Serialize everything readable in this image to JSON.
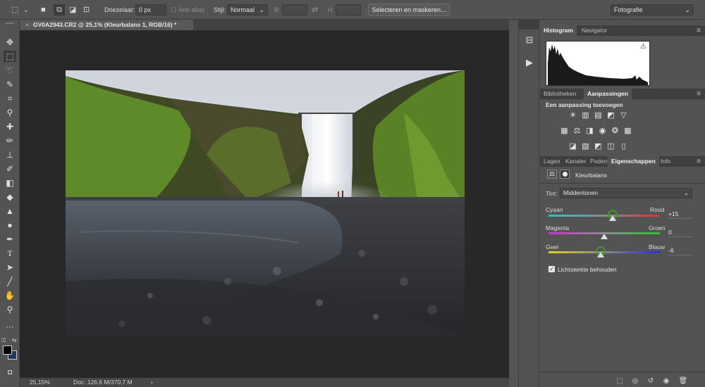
{
  "options_bar": {
    "feather_label": "Doezelaar:",
    "feather_value": "0 px",
    "antialias_label": "Anti-alias",
    "style_label": "Stijl:",
    "style_value": "Normaal",
    "width_label": "B:",
    "height_label": "H:",
    "select_mask_button": "Selecteren en maskeren...",
    "workspace_value": "Fotografie"
  },
  "document_tab": {
    "close_glyph": "×",
    "title": "GV0A2943.CR2 @ 25,1% (Kleurbalans 1, RGB/16) *"
  },
  "status_bar": {
    "zoom": "25,15%",
    "doc_info": "Doc: 126,6 M/370,7 M",
    "arrow": "›"
  },
  "panels": {
    "histogram_tabs": [
      "Histogram",
      "Navigator"
    ],
    "histogram_warning": "⚠",
    "library_tabs": [
      "Bibliotheken",
      "Aanpassingen"
    ],
    "adjustments_heading": "Een aanpassing toevoegen",
    "properties_tabs": [
      "Lagen",
      "Kanaler",
      "Paden",
      "Eigenschappen",
      "Info"
    ],
    "properties_title": "Kleurbalans",
    "tone_label": "Tint:",
    "tone_value": "Middentonen",
    "sliders": [
      {
        "left": "Cyaan",
        "right": "Rood",
        "value": "+15",
        "level": 15
      },
      {
        "left": "Magenta",
        "right": "Groen",
        "value": "0",
        "level": 0
      },
      {
        "left": "Geel",
        "right": "Blauw",
        "value": "-6",
        "level": -6
      }
    ],
    "preserve_luminosity": "Lichtsterkte behouden",
    "menu_glyph": "≡"
  },
  "colors": {
    "ui_bg": "#535353",
    "canvas_bg": "#282828",
    "highlight_ring": "#3f9a2a",
    "foreground_swatch": "#000000",
    "background_swatch": "#1f3a5a"
  }
}
